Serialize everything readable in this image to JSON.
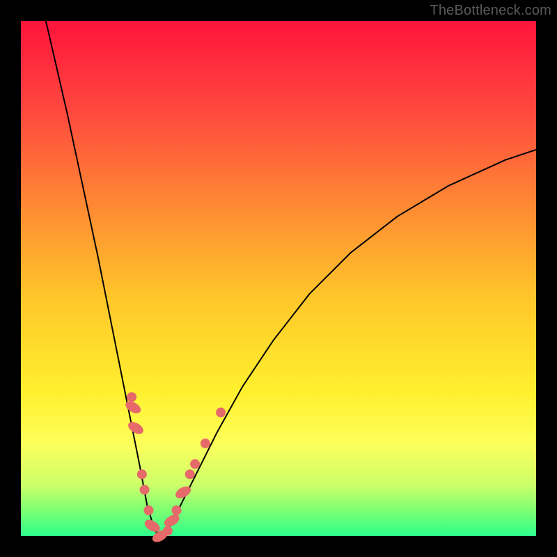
{
  "watermark": "TheBottleneck.com",
  "chart_data": {
    "type": "line",
    "title": "",
    "xlabel": "",
    "ylabel": "",
    "xlim": [
      0,
      100
    ],
    "ylim": [
      0,
      100
    ],
    "grid": false,
    "legend": false,
    "description": "V-shaped bottleneck curve on a red-to-green vertical gradient. Lower y values (green) indicate balanced components; higher y values (red) indicate bottleneck. A cluster of salmon data-point markers sits near the curve minimum.",
    "series": [
      {
        "name": "bottleneck-curve",
        "x": [
          0,
          3,
          6,
          9,
          12,
          15,
          17,
          19,
          21,
          23,
          24.5,
          26,
          27.5,
          29,
          31,
          34,
          38,
          43,
          49,
          56,
          64,
          73,
          83,
          94,
          100
        ],
        "values": [
          120,
          108,
          95,
          82,
          68,
          54,
          44,
          34,
          24,
          14,
          6,
          1,
          0,
          2,
          6,
          12,
          20,
          29,
          38,
          47,
          55,
          62,
          68,
          73,
          75
        ]
      }
    ],
    "markers": [
      {
        "x": 21.5,
        "y": 27,
        "shape": "circle"
      },
      {
        "x": 21.8,
        "y": 25,
        "shape": "pill"
      },
      {
        "x": 22.3,
        "y": 21,
        "shape": "pill"
      },
      {
        "x": 23.5,
        "y": 12,
        "shape": "circle"
      },
      {
        "x": 24.0,
        "y": 9,
        "shape": "circle"
      },
      {
        "x": 24.8,
        "y": 5,
        "shape": "circle"
      },
      {
        "x": 25.5,
        "y": 2,
        "shape": "pill"
      },
      {
        "x": 27.0,
        "y": 0,
        "shape": "pill"
      },
      {
        "x": 28.5,
        "y": 1,
        "shape": "circle"
      },
      {
        "x": 29.3,
        "y": 3,
        "shape": "pill"
      },
      {
        "x": 30.2,
        "y": 5,
        "shape": "circle"
      },
      {
        "x": 31.5,
        "y": 8.5,
        "shape": "pill"
      },
      {
        "x": 32.8,
        "y": 12,
        "shape": "circle"
      },
      {
        "x": 33.8,
        "y": 14,
        "shape": "circle"
      },
      {
        "x": 35.8,
        "y": 18,
        "shape": "circle"
      },
      {
        "x": 38.8,
        "y": 24,
        "shape": "circle"
      }
    ],
    "gradient_stops": [
      {
        "pos": 0,
        "color": "#ff143c"
      },
      {
        "pos": 18,
        "color": "#ff4a3e"
      },
      {
        "pos": 36,
        "color": "#ff8a33"
      },
      {
        "pos": 54,
        "color": "#ffc72a"
      },
      {
        "pos": 72,
        "color": "#fff02e"
      },
      {
        "pos": 82,
        "color": "#fdff5a"
      },
      {
        "pos": 90,
        "color": "#cdff6a"
      },
      {
        "pos": 95,
        "color": "#7dff72"
      },
      {
        "pos": 100,
        "color": "#2dff8c"
      }
    ],
    "marker_color": "#e66a6a"
  }
}
